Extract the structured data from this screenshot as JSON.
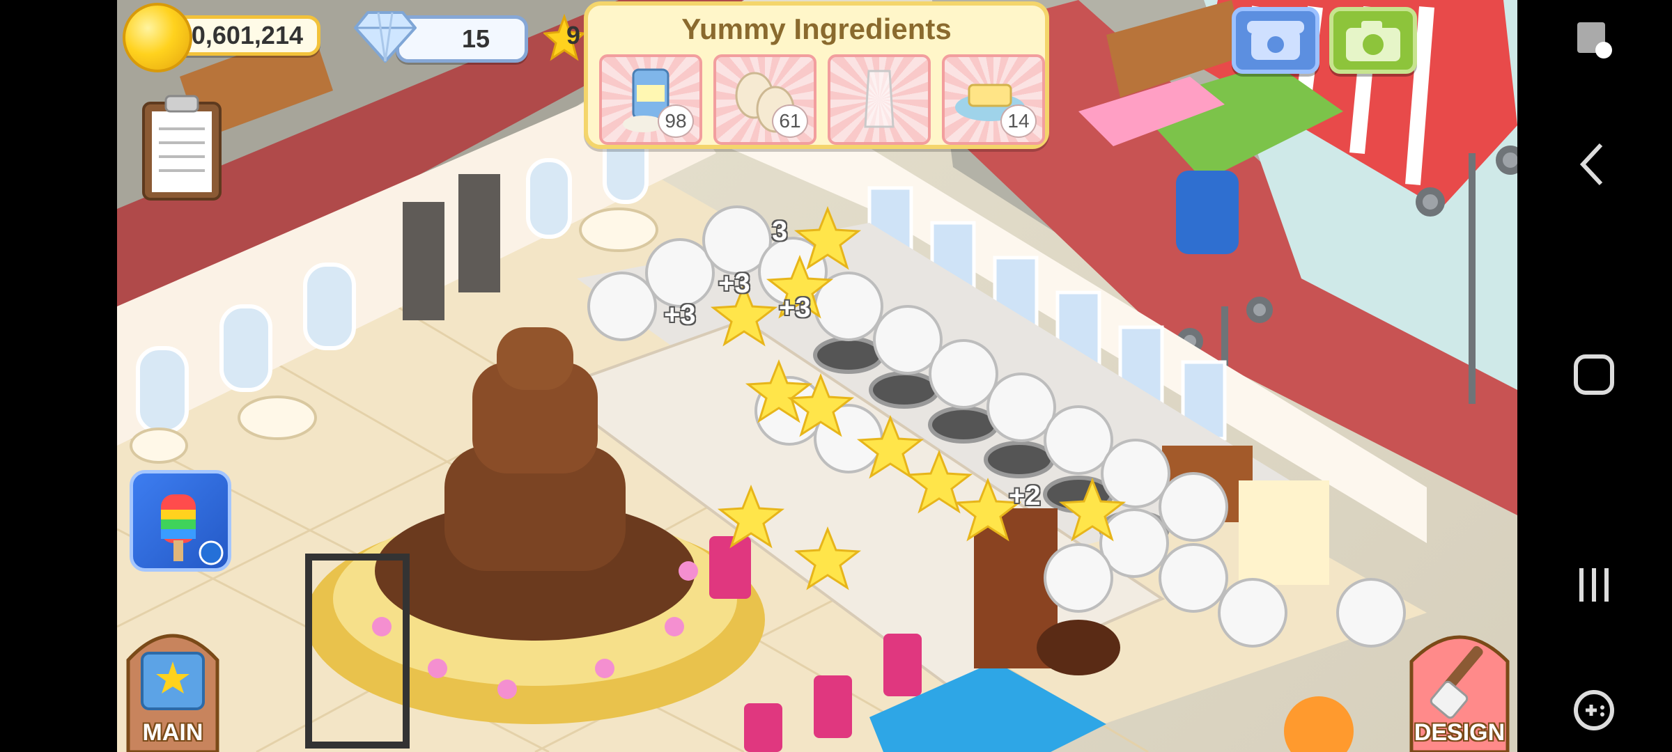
{
  "hud": {
    "coins": "40,601,214",
    "gems": "15",
    "bonus_partial": "9"
  },
  "ingredients_panel": {
    "title": "Yummy Ingredients",
    "items": [
      {
        "name": "flour",
        "count": "98"
      },
      {
        "name": "eggs",
        "count": "61"
      },
      {
        "name": "milk",
        "count": ""
      },
      {
        "name": "butter",
        "count": "14"
      }
    ]
  },
  "floating_rewards": [
    "+3",
    "+3",
    "+3",
    "+2",
    "3"
  ],
  "buttons": {
    "main_label": "MAIN",
    "design_label": "DESIGN",
    "account_symbol": "$"
  },
  "colors": {
    "coin": "#ffd21e",
    "gem_border": "#86a7d6",
    "panel_bg": "#fff6c9",
    "phone_button": "#5c8fe0",
    "camera_button": "#8dc43b",
    "account_button": "#2470d8"
  }
}
